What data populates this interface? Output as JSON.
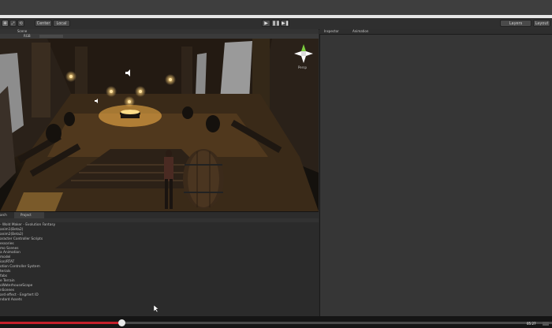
{
  "toolbar": {
    "transform_tools": [
      "✥",
      "⤢",
      "⟲"
    ],
    "pivot_label": "Center",
    "space_label": "Local",
    "play_controls": [
      "▶",
      "❚❚",
      "▶❚"
    ],
    "layers_label": "Layers",
    "layout_label": "Layout"
  },
  "scene": {
    "tab_label": "Scene",
    "draw_mode_label": "RGB",
    "gizmo_label": "Persp"
  },
  "right_panel": {
    "tabs": [
      "Inspector",
      "Animation"
    ]
  },
  "bottom_panel": {
    "tabs": [
      "arch",
      "Project"
    ],
    "items": [
      "- Wold Maker - Evolution Fantasy",
      "anim1(Beta2)",
      "anim2(Beta2)",
      "aracter Controller Scripts",
      "essories",
      "mo Scenes",
      "a Animation",
      "model",
      "ion/RTAT",
      "otion Controller System",
      "terials",
      "fabs",
      "e Terrain",
      "oWaterhouseScape",
      "nScenes",
      "ard effect - Engrtert ID",
      "ndard Assets"
    ]
  },
  "video": {
    "progress_fraction": 0.22,
    "time_label": "05:27"
  },
  "colors": {
    "accent": "#c41f2a",
    "panel": "#363636",
    "scene_bg": "#181410"
  }
}
